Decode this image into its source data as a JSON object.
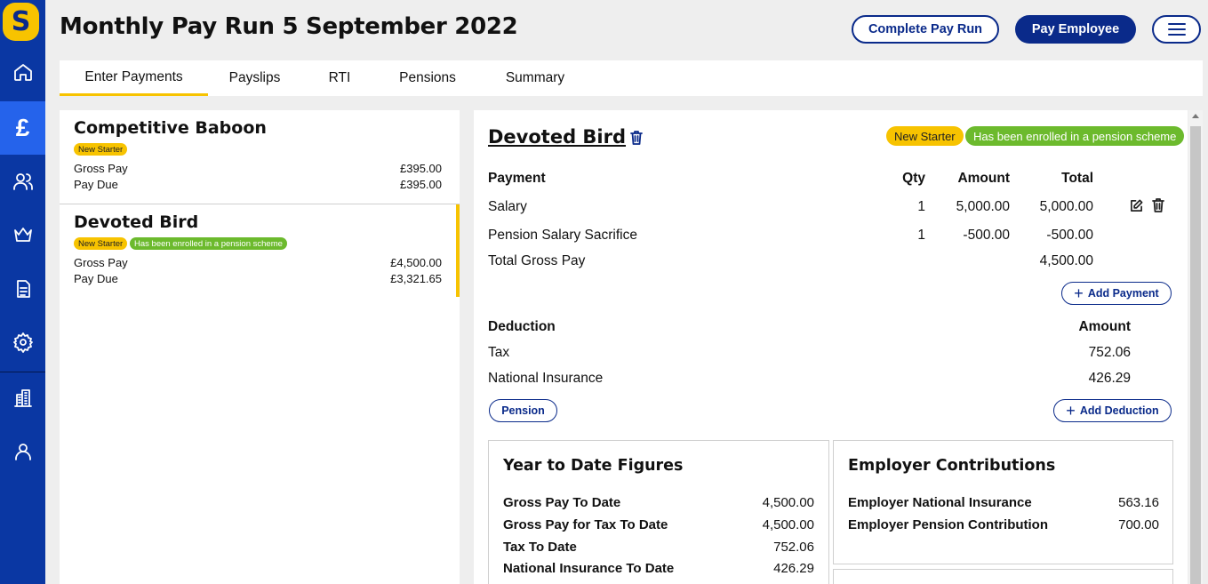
{
  "app": {
    "logo_letter": "S"
  },
  "sidebar": {
    "items": [
      {
        "name": "home-icon"
      },
      {
        "name": "pound-icon",
        "label": "£",
        "active": true
      },
      {
        "name": "people-icon"
      },
      {
        "name": "crown-icon"
      },
      {
        "name": "document-icon"
      },
      {
        "name": "gear-icon"
      },
      {
        "name": "building-icon"
      },
      {
        "name": "user-icon"
      }
    ]
  },
  "header": {
    "title": "Monthly Pay Run 5 September 2022",
    "complete_label": "Complete Pay Run",
    "pay_label": "Pay Employee",
    "menu_icon": "hamburger-icon"
  },
  "tabs": [
    "Enter Payments",
    "Payslips",
    "RTI",
    "Pensions",
    "Summary"
  ],
  "employees": [
    {
      "name": "Competitive Baboon",
      "badges": [
        "New Starter"
      ],
      "gross_label": "Gross Pay",
      "gross": "£395.00",
      "due_label": "Pay Due",
      "due": "£395.00"
    },
    {
      "name": "Devoted Bird",
      "badges": [
        "New Starter",
        "Has been enrolled in a pension scheme"
      ],
      "gross_label": "Gross Pay",
      "gross": "£4,500.00",
      "due_label": "Pay Due",
      "due": "£3,321.65"
    }
  ],
  "detail": {
    "name": "Devoted Bird",
    "badges": [
      "New Starter",
      "Has been enrolled in a pension scheme"
    ],
    "payments": {
      "headers": {
        "payment": "Payment",
        "qty": "Qty",
        "amount": "Amount",
        "total": "Total"
      },
      "rows": [
        {
          "label": "Salary",
          "qty": "1",
          "amount": "5,000.00",
          "total": "5,000.00"
        },
        {
          "label": "Pension Salary Sacrifice",
          "qty": "1",
          "amount": "-500.00",
          "total": "-500.00"
        }
      ],
      "total_label": "Total Gross Pay",
      "total": "4,500.00",
      "add_label": "Add Payment"
    },
    "deductions": {
      "headers": {
        "deduction": "Deduction",
        "amount": "Amount"
      },
      "rows": [
        {
          "label": "Tax",
          "amount": "752.06"
        },
        {
          "label": "National Insurance",
          "amount": "426.29"
        }
      ],
      "pension_label": "Pension",
      "add_label": "Add Deduction"
    },
    "ytd": {
      "title": "Year to Date Figures",
      "rows": [
        {
          "label": "Gross Pay To Date",
          "value": "4,500.00"
        },
        {
          "label": "Gross Pay for Tax To Date",
          "value": "4,500.00"
        },
        {
          "label": "Tax To Date",
          "value": "752.06"
        },
        {
          "label": "National Insurance To Date",
          "value": "426.29"
        }
      ]
    },
    "employer": {
      "title": "Employer Contributions",
      "rows": [
        {
          "label": "Employer National Insurance",
          "value": "563.16"
        },
        {
          "label": "Employer Pension Contribution",
          "value": "700.00"
        }
      ]
    }
  },
  "colors": {
    "brand_blue": "#0a37a3",
    "accent_yellow": "#f7c300",
    "pension_green": "#6cba2d"
  }
}
